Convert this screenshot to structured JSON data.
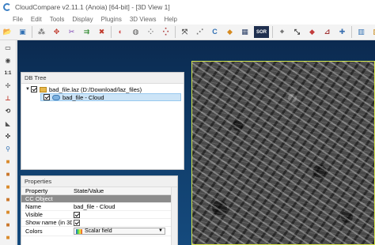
{
  "app": {
    "title": "CloudCompare v2.11.1 (Anoia) [64-bit] - [3D View 1]"
  },
  "menu": {
    "items": [
      "File",
      "Edit",
      "Tools",
      "Display",
      "Plugins",
      "3D Views",
      "Help"
    ]
  },
  "toolbar": {
    "buttons": [
      {
        "name": "open-icon",
        "glyph": "📂",
        "color": "#d9a53a"
      },
      {
        "name": "save-icon",
        "glyph": "▣",
        "color": "#2f6fb3"
      },
      {
        "name": "sep"
      },
      {
        "name": "cloud-select-icon",
        "glyph": "⁂",
        "color": "#6a6a6a"
      },
      {
        "name": "multi-cloud-icon",
        "glyph": "✥",
        "color": "#c0392b"
      },
      {
        "name": "segment-icon",
        "glyph": "✂",
        "color": "#7a3fb0"
      },
      {
        "name": "merge-icon",
        "glyph": "⇉",
        "color": "#3a8f3a"
      },
      {
        "name": "delete-icon",
        "glyph": "✖",
        "color": "#c0392b"
      },
      {
        "name": "sep"
      },
      {
        "name": "color-scale-icon",
        "glyph": "◐",
        "color": "#d04545"
      },
      {
        "name": "normals-icon",
        "glyph": "◍",
        "color": "#555555"
      },
      {
        "name": "sample-icon",
        "glyph": "⁘",
        "color": "#7a7a7a"
      },
      {
        "name": "subsample-icon",
        "glyph": "⁛",
        "color": "#b04040"
      },
      {
        "name": "sep"
      },
      {
        "name": "distance-icon",
        "glyph": "⤧",
        "color": "#444444"
      },
      {
        "name": "c2c-icon",
        "glyph": "⋰",
        "color": "#777777"
      },
      {
        "name": "cc-icon",
        "glyph": "C",
        "color": "#2f6fb3"
      },
      {
        "name": "compare-icon",
        "glyph": "◆",
        "color": "#d68a1f"
      },
      {
        "name": "noise-icon",
        "glyph": "▦",
        "color": "#2b3f66"
      },
      {
        "name": "sor-filter-icon",
        "glyph": "SOR",
        "color": "#222222"
      },
      {
        "name": "sep"
      },
      {
        "name": "pick-point-icon",
        "glyph": "⌖",
        "color": "#6a6a6a"
      },
      {
        "name": "measure-icon",
        "glyph": "⤡",
        "color": "#3a3a3a"
      },
      {
        "name": "plane-icon",
        "glyph": "◆",
        "color": "#c23b3b"
      },
      {
        "name": "clip-icon",
        "glyph": "⊿",
        "color": "#a03030"
      },
      {
        "name": "register-icon",
        "glyph": "✚",
        "color": "#3a6fb0"
      },
      {
        "name": "sep"
      },
      {
        "name": "histogram-icon",
        "glyph": "▥",
        "color": "#2f6fb3"
      },
      {
        "name": "bar-chart-icon",
        "glyph": "▨",
        "color": "#c98a1a"
      },
      {
        "name": "scalar-field-icon",
        "glyph": "▩",
        "color": "#3a8f3a"
      }
    ]
  },
  "left_toolbar": {
    "buttons": [
      {
        "name": "screen-icon",
        "glyph": "▭",
        "color": "#333333"
      },
      {
        "name": "camera-icon",
        "glyph": "◉",
        "color": "#444444"
      },
      {
        "name": "zoom-1to1-icon",
        "glyph": "1:1",
        "color": "#222222"
      },
      {
        "name": "pivot-icon",
        "glyph": "✢",
        "color": "#444444"
      },
      {
        "name": "axis-icon",
        "glyph": "⊥",
        "color": "#c0392b"
      },
      {
        "name": "rotate-icon",
        "glyph": "⟲",
        "color": "#333333"
      },
      {
        "name": "pan-icon",
        "glyph": "◣",
        "color": "#555555"
      },
      {
        "name": "move-icon",
        "glyph": "✜",
        "color": "#333333"
      },
      {
        "name": "zoom-icon",
        "glyph": "⚲",
        "color": "#2f6fb3"
      },
      {
        "name": "cube-front-icon",
        "glyph": "■",
        "color": "#d98a2a"
      },
      {
        "name": "cube-top-icon",
        "glyph": "■",
        "color": "#c9762a"
      },
      {
        "name": "cube-side-icon",
        "glyph": "■",
        "color": "#d98a2a"
      },
      {
        "name": "cube-back-icon",
        "glyph": "■",
        "color": "#c9762a"
      },
      {
        "name": "cube-bottom-icon",
        "glyph": "■",
        "color": "#d98a2a"
      },
      {
        "name": "cube-iso-icon",
        "glyph": "■",
        "color": "#c9762a"
      },
      {
        "name": "cube-iso2-icon",
        "glyph": "■",
        "color": "#d98a2a"
      }
    ]
  },
  "db_tree": {
    "title": "DB Tree",
    "root_label": "bad_file.laz (D:/Download/laz_files)",
    "child_label": "bad_file - Cloud"
  },
  "properties": {
    "title": "Properties",
    "col_property": "Property",
    "col_value": "State/Value",
    "section": "CC Object",
    "name_key": "Name",
    "name_value": "bad_file - Cloud",
    "visible_key": "Visible",
    "show_name_key": "Show name (in 3D)",
    "colors_key": "Colors",
    "colors_value": "Scalar field"
  }
}
